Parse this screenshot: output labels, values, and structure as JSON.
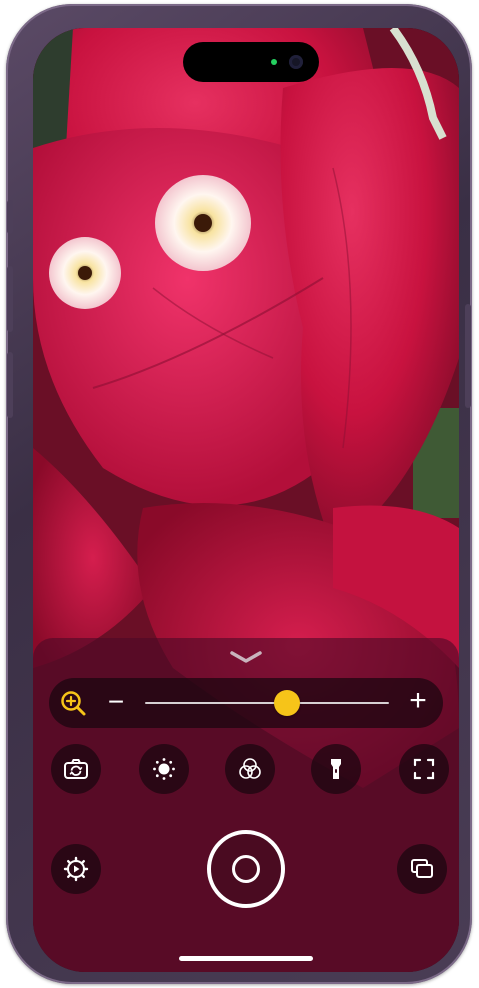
{
  "app": {
    "name": "Magnifier"
  },
  "zoom": {
    "minus_label": "−",
    "plus_label": "+",
    "level_fraction": 0.58
  },
  "controls": {
    "row1": [
      {
        "name": "switch-camera-icon"
      },
      {
        "name": "brightness-icon"
      },
      {
        "name": "filters-icon"
      },
      {
        "name": "flashlight-icon"
      },
      {
        "name": "fullscreen-icon"
      }
    ],
    "row2": [
      {
        "name": "settings-icon"
      },
      {
        "name": "shutter-button"
      },
      {
        "name": "gallery-icon"
      }
    ]
  },
  "colors": {
    "accent": "#f6c419",
    "panel": "#4e0a26",
    "control_bg": "#19050f"
  }
}
